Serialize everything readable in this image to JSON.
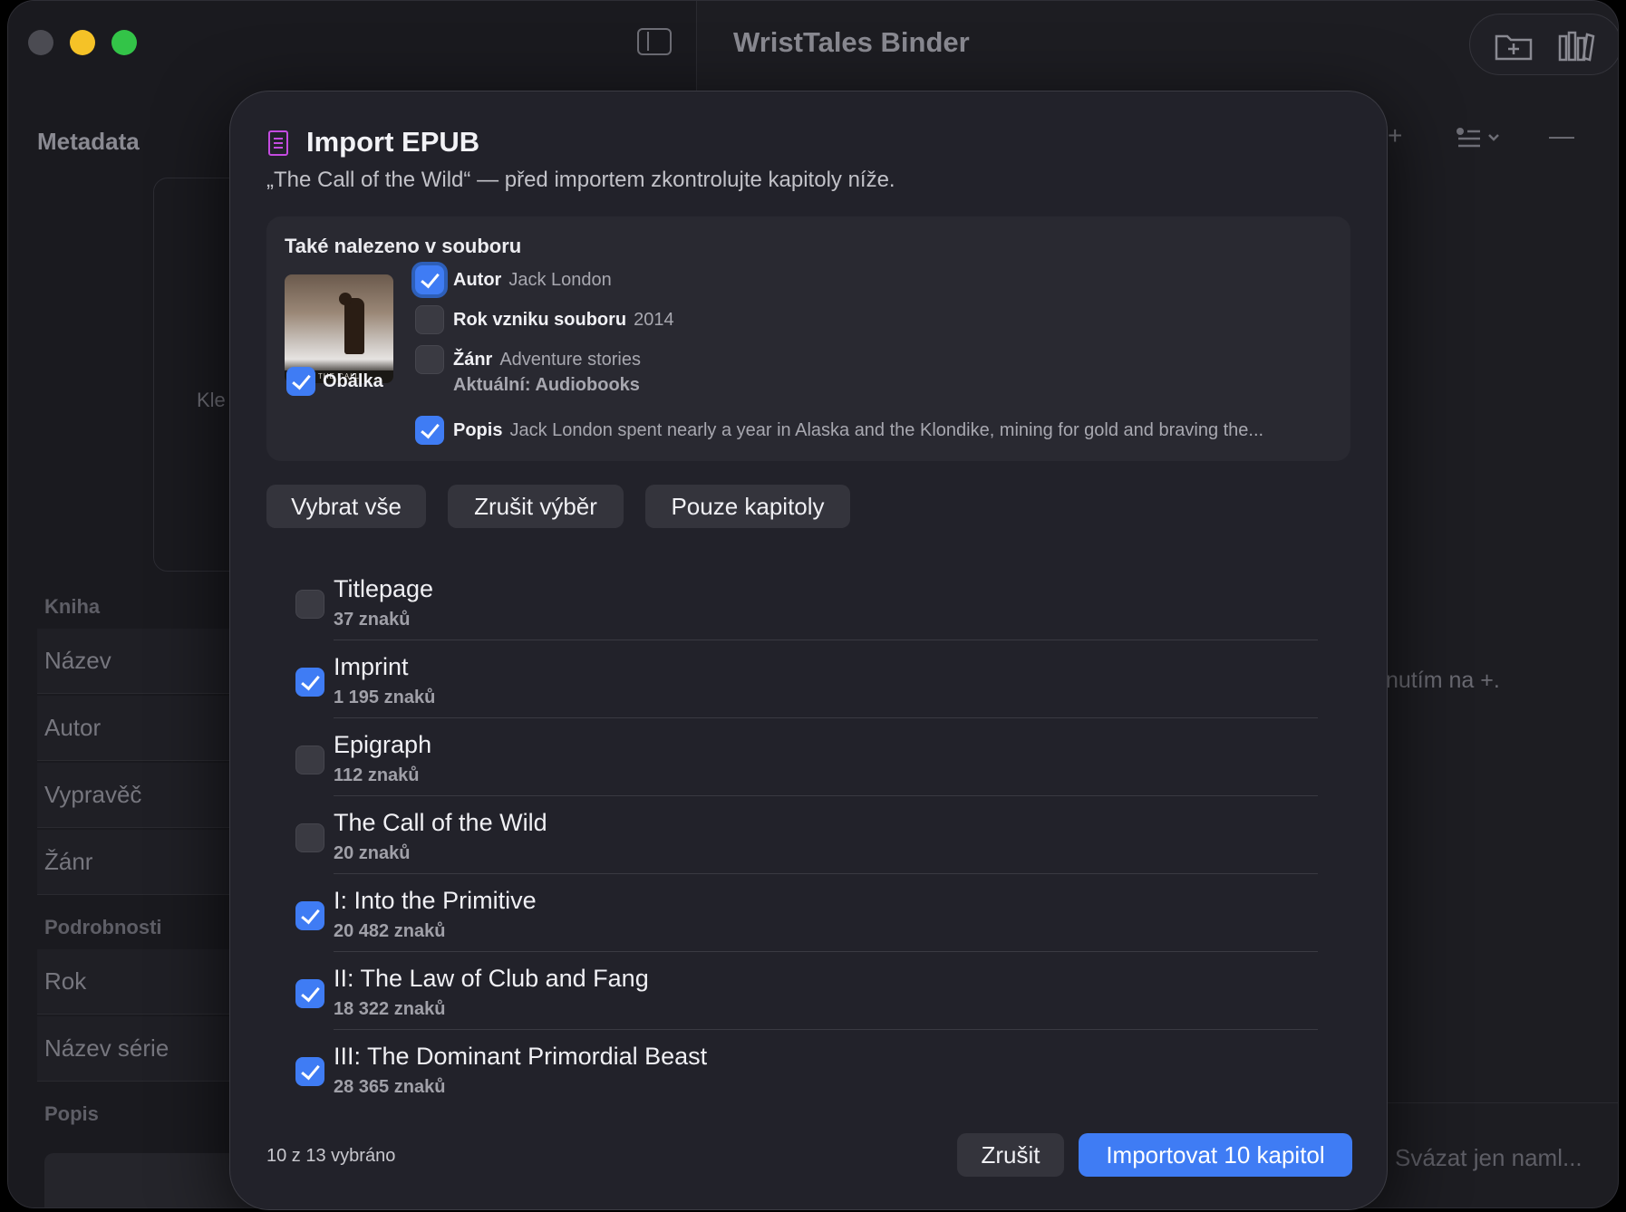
{
  "window": {
    "title": "WristTales Binder"
  },
  "sidebar": {
    "title": "Metadata",
    "drop_hint": "Kle",
    "sections": [
      {
        "label": "Kniha"
      },
      {
        "label": "Podrobnosti"
      },
      {
        "label": "Popis"
      }
    ],
    "fields": [
      "Název",
      "Autor",
      "Vypravěč",
      "Žánr",
      "Rok",
      "Název série"
    ]
  },
  "right_panel": {
    "hint": "nutím na +.",
    "footer": "Svázat jen naml..."
  },
  "modal": {
    "title": "Import EPUB",
    "subtitle": "„The Call of the Wild“ — před importem zkontrolujte kapitoly níže.",
    "found": {
      "title": "Také nalezeno v souboru",
      "cover_label": "Obálka",
      "cover_checked": true,
      "cover_strip_text": "THE CALL",
      "items": [
        {
          "label": "Autor",
          "value": "Jack London",
          "checked": true
        },
        {
          "label": "Rok vzniku souboru",
          "value": "2014",
          "checked": false
        },
        {
          "label": "Žánr",
          "value": "Adventure stories",
          "current": "Aktuální: Audiobooks",
          "checked": false
        },
        {
          "label": "Popis",
          "value": "Jack London spent nearly a year in Alaska and the Klondike, mining for gold and braving the...",
          "checked": true
        }
      ]
    },
    "buttons": {
      "select_all": "Vybrat vše",
      "deselect": "Zrušit výběr",
      "chapters_only": "Pouze kapitoly"
    },
    "chapters": [
      {
        "name": "Titlepage",
        "count": "37 znaků",
        "checked": false
      },
      {
        "name": "Imprint",
        "count": "1 195 znaků",
        "checked": true
      },
      {
        "name": "Epigraph",
        "count": "112 znaků",
        "checked": false
      },
      {
        "name": "The Call of the Wild",
        "count": "20 znaků",
        "checked": false
      },
      {
        "name": "I: Into the Primitive",
        "count": "20 482 znaků",
        "checked": true
      },
      {
        "name": "II: The Law of Club and Fang",
        "count": "18 322 znaků",
        "checked": true
      },
      {
        "name": "III: The Dominant Primordial Beast",
        "count": "28 365 znaků",
        "checked": true
      }
    ],
    "footer": {
      "selected_count": "10 z 13 vybráno",
      "cancel": "Zrušit",
      "import": "Importovat 10 kapitol"
    }
  },
  "colors": {
    "accent": "#3f7cf4",
    "icon_accent": "#c44be0"
  },
  "icons": {
    "sidebar_toggle": "sidebar-icon",
    "toolbar_a": "folder-add-icon",
    "toolbar_b": "library-icon",
    "modal": "book-icon"
  }
}
